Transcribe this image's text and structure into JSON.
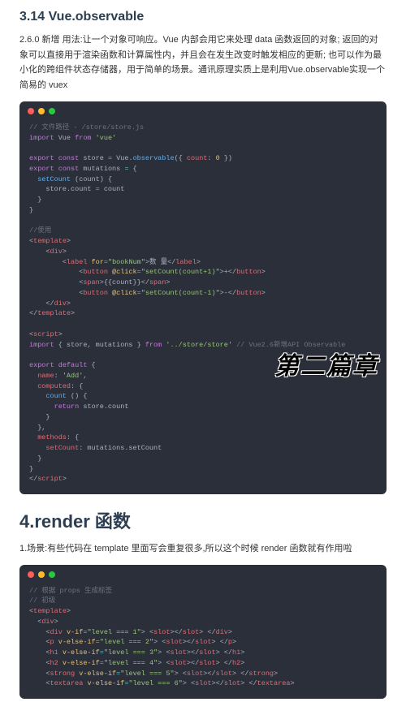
{
  "section1": {
    "heading": "3.14 Vue.observable",
    "paragraph": "2.6.0 新增 用法:让一个对象可响应。Vue 内部会用它来处理 data 函数返回的对象; 返回的对象可以直接用于渲染函数和计算属性内，并且会在发生改变时触发相应的更新; 也可以作为最小化的跨组件状态存储器，用于简单的场景。通讯原理实质上是利用Vue.observable实现一个简易的 vuex"
  },
  "code1": {
    "lines": [
      [
        [
          "cm",
          "// 文件路径 - /store/store.js"
        ]
      ],
      [
        [
          "kw",
          "import"
        ],
        [
          "pl",
          " Vue "
        ],
        [
          "kw",
          "from"
        ],
        [
          "pl",
          " "
        ],
        [
          "st",
          "'vue'"
        ]
      ],
      [],
      [
        [
          "kw",
          "export"
        ],
        [
          "pl",
          " "
        ],
        [
          "kw",
          "const"
        ],
        [
          "pl",
          " store "
        ],
        [
          "op",
          "="
        ],
        [
          "pl",
          " Vue."
        ],
        [
          "fn",
          "observable"
        ],
        [
          "pl",
          "({ "
        ],
        [
          "pr",
          "count"
        ],
        [
          "pl",
          ": "
        ],
        [
          "nm",
          "0"
        ],
        [
          "pl",
          " })"
        ]
      ],
      [
        [
          "kw",
          "export"
        ],
        [
          "pl",
          " "
        ],
        [
          "kw",
          "const"
        ],
        [
          "pl",
          " mutations "
        ],
        [
          "op",
          "="
        ],
        [
          "pl",
          " {"
        ]
      ],
      [
        [
          "pl",
          "  "
        ],
        [
          "fn",
          "setCount"
        ],
        [
          "pl",
          " (count) {"
        ]
      ],
      [
        [
          "pl",
          "    store.count "
        ],
        [
          "op",
          "="
        ],
        [
          "pl",
          " count"
        ]
      ],
      [
        [
          "pl",
          "  }"
        ]
      ],
      [
        [
          "pl",
          "}"
        ]
      ],
      [],
      [
        [
          "cm",
          "//使用"
        ]
      ],
      [
        [
          "pl",
          "<"
        ],
        [
          "pr",
          "template"
        ],
        [
          "pl",
          ">"
        ]
      ],
      [
        [
          "pl",
          "    <"
        ],
        [
          "pr",
          "div"
        ],
        [
          "pl",
          ">"
        ]
      ],
      [
        [
          "pl",
          "        <"
        ],
        [
          "pr",
          "label"
        ],
        [
          "pl",
          " "
        ],
        [
          "nm",
          "for"
        ],
        [
          "op",
          "="
        ],
        [
          "st",
          "\"bookNum\""
        ],
        [
          "pl",
          ">数 量</"
        ],
        [
          "pr",
          "label"
        ],
        [
          "pl",
          ">"
        ]
      ],
      [
        [
          "pl",
          "            <"
        ],
        [
          "pr",
          "button"
        ],
        [
          "pl",
          " "
        ],
        [
          "nm",
          "@click"
        ],
        [
          "op",
          "="
        ],
        [
          "st",
          "\"setCount(count+1)\""
        ],
        [
          "pl",
          ">+</"
        ],
        [
          "pr",
          "button"
        ],
        [
          "pl",
          ">"
        ]
      ],
      [
        [
          "pl",
          "            <"
        ],
        [
          "pr",
          "span"
        ],
        [
          "pl",
          ">{{count}}</"
        ],
        [
          "pr",
          "span"
        ],
        [
          "pl",
          ">"
        ]
      ],
      [
        [
          "pl",
          "            <"
        ],
        [
          "pr",
          "button"
        ],
        [
          "pl",
          " "
        ],
        [
          "nm",
          "@click"
        ],
        [
          "op",
          "="
        ],
        [
          "st",
          "\"setCount(count-1)\""
        ],
        [
          "pl",
          ">-</"
        ],
        [
          "pr",
          "button"
        ],
        [
          "pl",
          ">"
        ]
      ],
      [
        [
          "pl",
          "    </"
        ],
        [
          "pr",
          "div"
        ],
        [
          "pl",
          ">"
        ]
      ],
      [
        [
          "pl",
          "</"
        ],
        [
          "pr",
          "template"
        ],
        [
          "pl",
          ">"
        ]
      ],
      [],
      [
        [
          "pl",
          "<"
        ],
        [
          "pr",
          "script"
        ],
        [
          "pl",
          ">"
        ]
      ],
      [
        [
          "kw",
          "import"
        ],
        [
          "pl",
          " { store, mutations } "
        ],
        [
          "kw",
          "from"
        ],
        [
          "pl",
          " "
        ],
        [
          "st",
          "'../store/store'"
        ],
        [
          "pl",
          " "
        ],
        [
          "cm",
          "// Vue2.6新增API Observable"
        ]
      ],
      [],
      [
        [
          "kw",
          "export"
        ],
        [
          "pl",
          " "
        ],
        [
          "kw",
          "default"
        ],
        [
          "pl",
          " {"
        ]
      ],
      [
        [
          "pl",
          "  "
        ],
        [
          "pr",
          "name"
        ],
        [
          "pl",
          ": "
        ],
        [
          "st",
          "'Add'"
        ],
        [
          "pl",
          ","
        ]
      ],
      [
        [
          "pl",
          "  "
        ],
        [
          "pr",
          "computed"
        ],
        [
          "pl",
          ": {"
        ]
      ],
      [
        [
          "pl",
          "    "
        ],
        [
          "fn",
          "count"
        ],
        [
          "pl",
          " () {"
        ]
      ],
      [
        [
          "pl",
          "      "
        ],
        [
          "kw",
          "return"
        ],
        [
          "pl",
          " store.count"
        ]
      ],
      [
        [
          "pl",
          "    }"
        ]
      ],
      [
        [
          "pl",
          "  },"
        ]
      ],
      [
        [
          "pl",
          "  "
        ],
        [
          "pr",
          "methods"
        ],
        [
          "pl",
          ": {"
        ]
      ],
      [
        [
          "pl",
          "    "
        ],
        [
          "pr",
          "setCount"
        ],
        [
          "pl",
          ": mutations.setCount"
        ]
      ],
      [
        [
          "pl",
          "  }"
        ]
      ],
      [
        [
          "pl",
          "}"
        ]
      ],
      [
        [
          "pl",
          "</"
        ],
        [
          "pr",
          "script"
        ],
        [
          "pl",
          ">"
        ]
      ]
    ]
  },
  "overlay": "第二篇章",
  "section2": {
    "heading": "4.render 函数",
    "paragraph": "1.场景:有些代码在 template 里面写会重复很多,所以这个时候 render 函数就有作用啦"
  },
  "code2": {
    "lines": [
      [
        [
          "cm",
          "// 根据 props 生成标签"
        ]
      ],
      [
        [
          "cm",
          "// 初级"
        ]
      ],
      [
        [
          "pl",
          "<"
        ],
        [
          "pr",
          "template"
        ],
        [
          "pl",
          ">"
        ]
      ],
      [
        [
          "pl",
          "  <"
        ],
        [
          "pr",
          "div"
        ],
        [
          "pl",
          ">"
        ]
      ],
      [
        [
          "pl",
          "    <"
        ],
        [
          "pr",
          "div"
        ],
        [
          "pl",
          " "
        ],
        [
          "nm",
          "v-if"
        ],
        [
          "op",
          "="
        ],
        [
          "st",
          "\"level === 1\""
        ],
        [
          "pl",
          "> <"
        ],
        [
          "pr",
          "slot"
        ],
        [
          "pl",
          "></"
        ],
        [
          "pr",
          "slot"
        ],
        [
          "pl",
          "> </"
        ],
        [
          "pr",
          "div"
        ],
        [
          "pl",
          ">"
        ]
      ],
      [
        [
          "pl",
          "    <"
        ],
        [
          "pr",
          "p"
        ],
        [
          "pl",
          " "
        ],
        [
          "nm",
          "v-else-if"
        ],
        [
          "op",
          "="
        ],
        [
          "st",
          "\"level === 2\""
        ],
        [
          "pl",
          "> <"
        ],
        [
          "pr",
          "slot"
        ],
        [
          "pl",
          "></"
        ],
        [
          "pr",
          "slot"
        ],
        [
          "pl",
          "> </"
        ],
        [
          "pr",
          "p"
        ],
        [
          "pl",
          ">"
        ]
      ],
      [
        [
          "pl",
          "    <"
        ],
        [
          "pr",
          "h1"
        ],
        [
          "pl",
          " "
        ],
        [
          "nm",
          "v-else-if"
        ],
        [
          "op",
          "="
        ],
        [
          "st",
          "\"level === 3\""
        ],
        [
          "pl",
          "> <"
        ],
        [
          "pr",
          "slot"
        ],
        [
          "pl",
          "></"
        ],
        [
          "pr",
          "slot"
        ],
        [
          "pl",
          "> </"
        ],
        [
          "pr",
          "h1"
        ],
        [
          "pl",
          ">"
        ]
      ],
      [
        [
          "pl",
          "    <"
        ],
        [
          "pr",
          "h2"
        ],
        [
          "pl",
          " "
        ],
        [
          "nm",
          "v-else-if"
        ],
        [
          "op",
          "="
        ],
        [
          "st",
          "\"level === 4\""
        ],
        [
          "pl",
          "> <"
        ],
        [
          "pr",
          "slot"
        ],
        [
          "pl",
          "></"
        ],
        [
          "pr",
          "slot"
        ],
        [
          "pl",
          "> </"
        ],
        [
          "pr",
          "h2"
        ],
        [
          "pl",
          ">"
        ]
      ],
      [
        [
          "pl",
          "    <"
        ],
        [
          "pr",
          "strong"
        ],
        [
          "pl",
          " "
        ],
        [
          "nm",
          "v-else-if"
        ],
        [
          "op",
          "="
        ],
        [
          "st",
          "\"level === 5\""
        ],
        [
          "pl",
          "> <"
        ],
        [
          "pr",
          "slot"
        ],
        [
          "pl",
          "></"
        ],
        [
          "pr",
          "slot"
        ],
        [
          "pl",
          "> </"
        ],
        [
          "pr",
          "strong"
        ],
        [
          "pl",
          ">"
        ]
      ],
      [
        [
          "pl",
          "    <"
        ],
        [
          "pr",
          "textarea"
        ],
        [
          "pl",
          " "
        ],
        [
          "nm",
          "v-else-if"
        ],
        [
          "op",
          "="
        ],
        [
          "st",
          "\"level === 6\""
        ],
        [
          "pl",
          "> <"
        ],
        [
          "pr",
          "slot"
        ],
        [
          "pl",
          "></"
        ],
        [
          "pr",
          "slot"
        ],
        [
          "pl",
          "> </"
        ],
        [
          "pr",
          "textarea"
        ],
        [
          "pl",
          ">"
        ]
      ]
    ]
  }
}
